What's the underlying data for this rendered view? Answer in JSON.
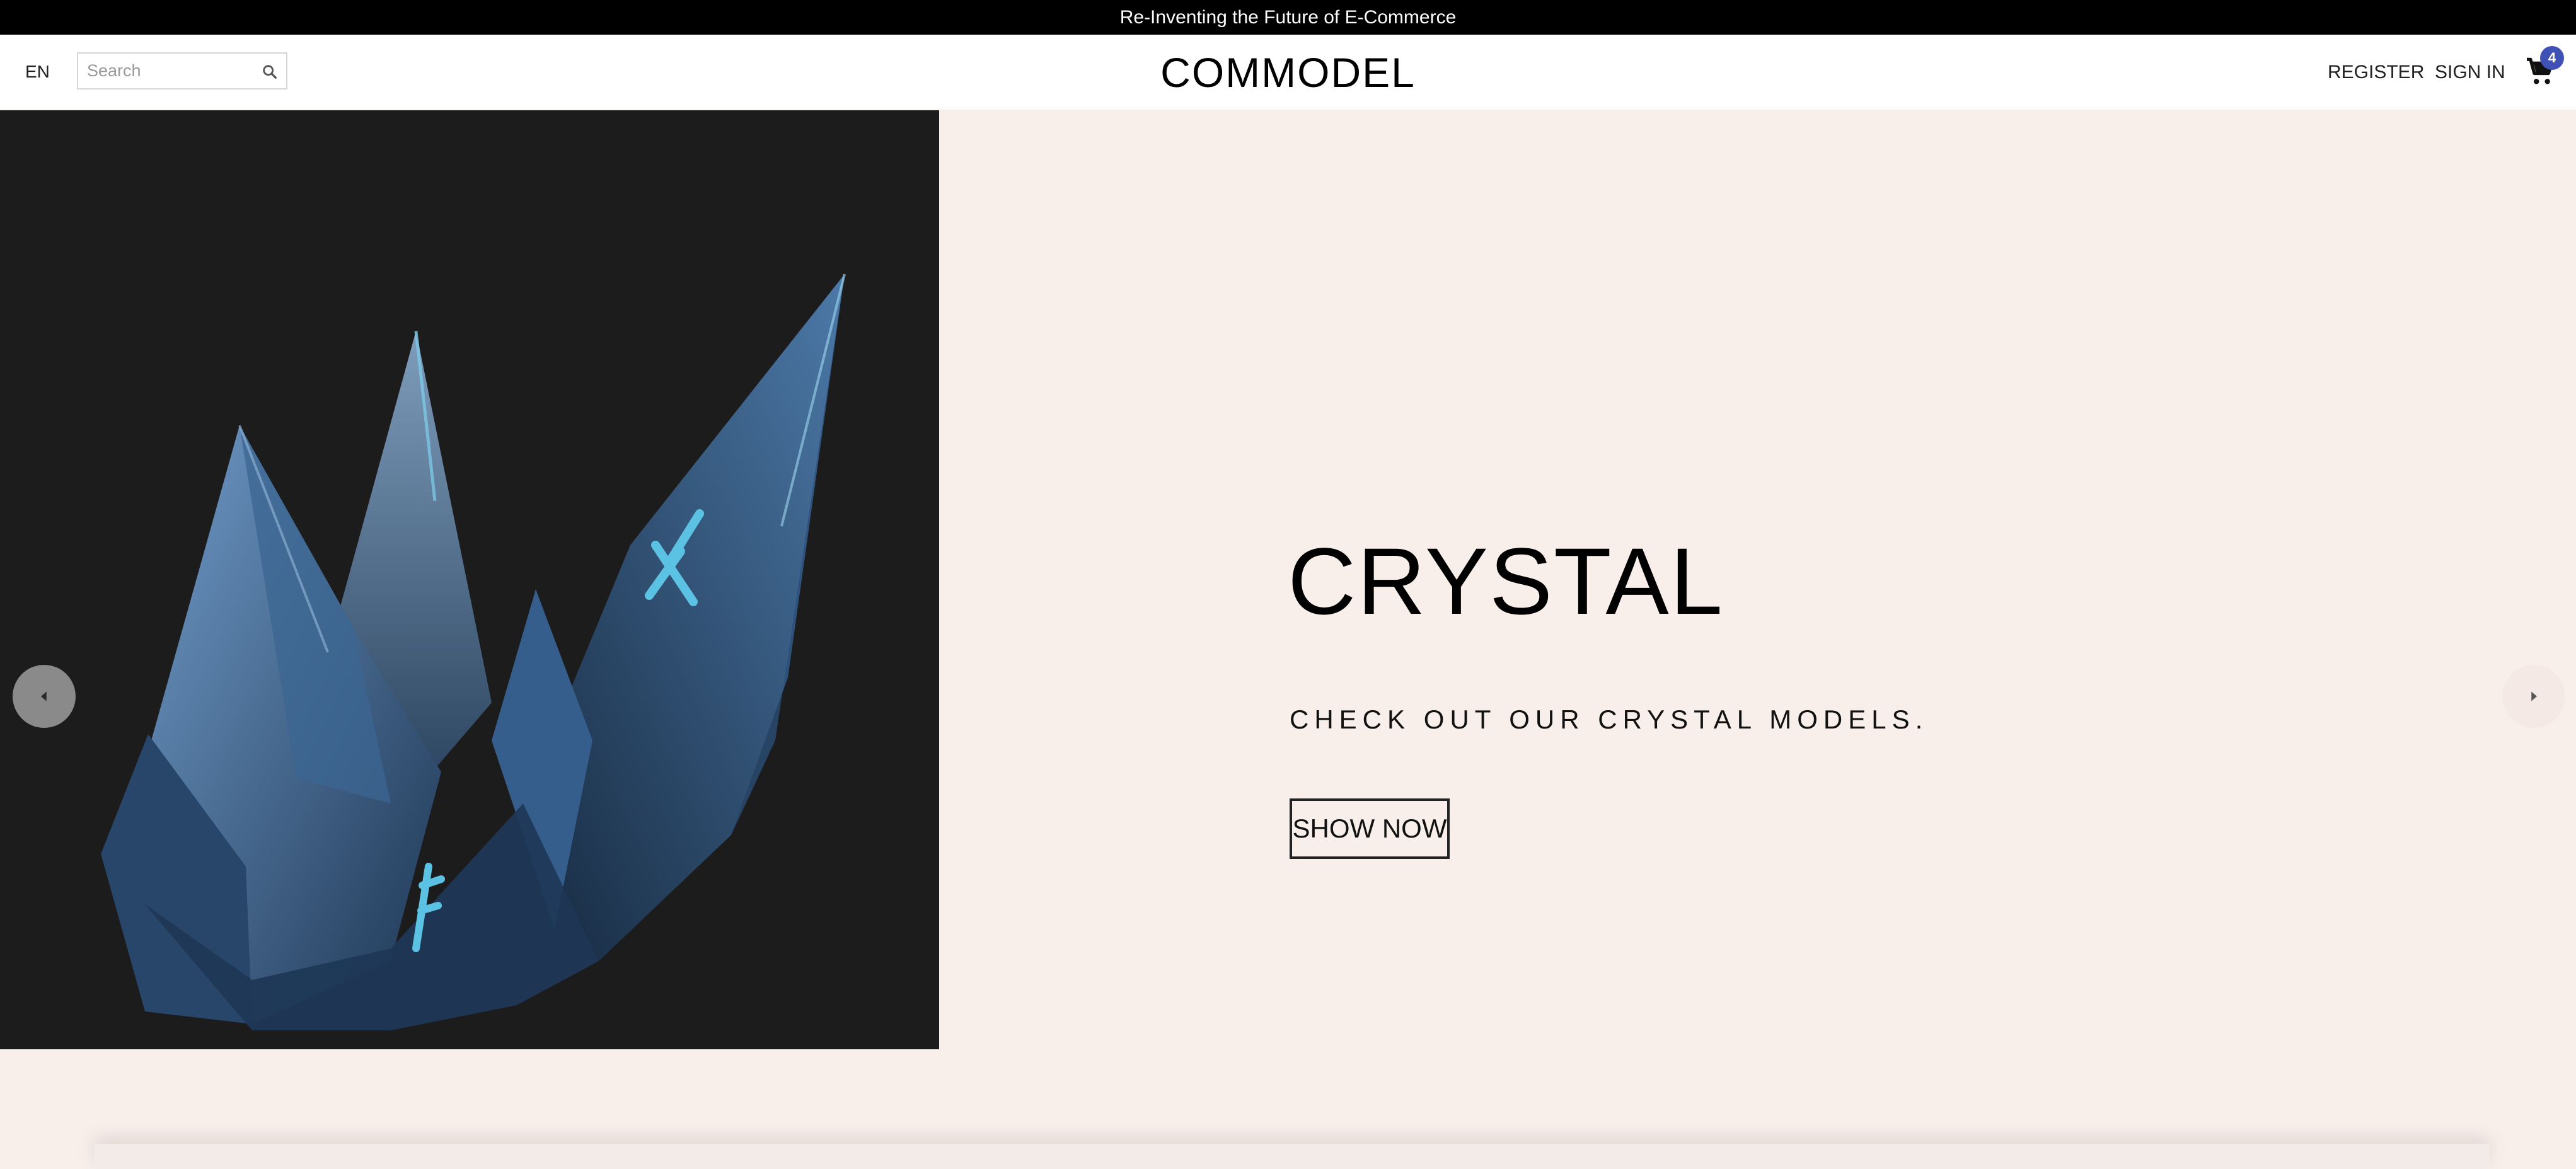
{
  "announcement": "Re-Inventing the Future of E-Commerce",
  "header": {
    "language": "EN",
    "search_placeholder": "Search",
    "logo": "COMMODEL",
    "register_label": "REGISTER",
    "signin_label": "SIGN IN",
    "cart_count": "4"
  },
  "hero": {
    "title": "CRYSTAL",
    "subtitle": "CHECK OUT OUR CRYSTAL MODELS.",
    "button_label": "SHOW NOW"
  },
  "icons": {
    "search": "search-icon",
    "cart": "shopping-cart-icon",
    "prev": "chevron-left-icon",
    "next": "chevron-right-icon"
  },
  "colors": {
    "announcement_bg": "#000000",
    "hero_bg": "#f8eeea",
    "image_bg": "#1c1c1c",
    "badge": "#3f51b5"
  }
}
